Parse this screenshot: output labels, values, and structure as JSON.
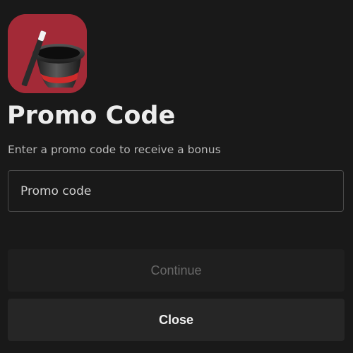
{
  "app": {
    "icon_name": "magic-hat-icon",
    "icon_color": "#a32a37"
  },
  "page": {
    "title": "Promo Code",
    "subtitle": "Enter a promo code to receive a bonus"
  },
  "promo_field": {
    "placeholder": "Promo code",
    "value": ""
  },
  "buttons": {
    "continue_label": "Continue",
    "continue_enabled": false,
    "close_label": "Close"
  },
  "colors": {
    "background": "#191919",
    "accent": "#a32a37"
  }
}
